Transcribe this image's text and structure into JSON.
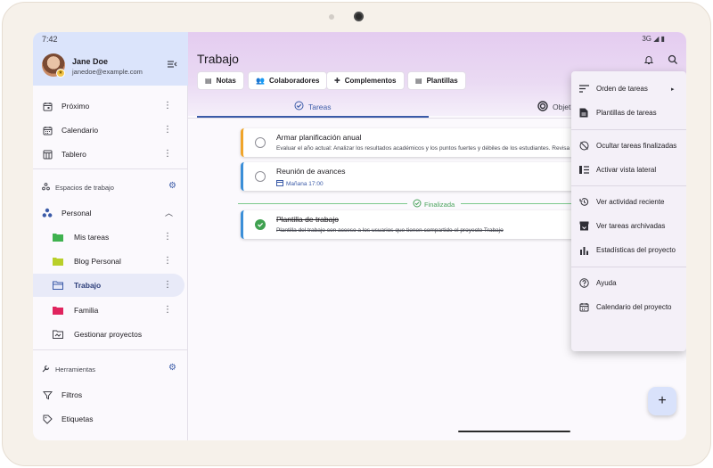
{
  "status": {
    "time": "7:42",
    "network": "3G"
  },
  "user": {
    "name": "Jane Doe",
    "email": "janedoe@example.com"
  },
  "sidebar": {
    "items": [
      {
        "label": "Próximo"
      },
      {
        "label": "Calendario"
      },
      {
        "label": "Tablero"
      }
    ],
    "workspaces_title": "Espacios de trabajo",
    "workspace": {
      "label": "Personal"
    },
    "projects": [
      {
        "label": "Mis tareas",
        "color": "#3fb24f"
      },
      {
        "label": "Blog Personal",
        "color": "#b9cf2a"
      },
      {
        "label": "Trabajo",
        "color": "#3b5ba8"
      },
      {
        "label": "Familia",
        "color": "#e0245e"
      }
    ],
    "manage_label": "Gestionar proyectos",
    "tools_title": "Herramientas",
    "tools": [
      {
        "label": "Filtros"
      },
      {
        "label": "Etiquetas"
      }
    ]
  },
  "main": {
    "title": "Trabajo",
    "chips": [
      {
        "label": "Notas",
        "icon": "note-icon"
      },
      {
        "label": "Colaboradores",
        "icon": "people-icon"
      },
      {
        "label": "Complementos",
        "icon": "puzzle-icon"
      },
      {
        "label": "Plantillas",
        "icon": "template-icon"
      }
    ],
    "tabs": [
      {
        "label": "Tareas",
        "icon": "check-circle-icon"
      },
      {
        "label": "Objeti",
        "icon": "target-icon"
      }
    ],
    "tasks": [
      {
        "title": "Armar planificación anual",
        "description": "Evaluar el año actual: Analizar los resultados académicos y los puntos fuertes y débiles de los estudiantes. Revisa",
        "accent": "#f0a52a"
      },
      {
        "title": "Reunión de avances",
        "due": "Mañana 17:00",
        "accent": "#3b8fd8"
      }
    ],
    "done_label": "Finalizada",
    "done_tasks": [
      {
        "title": "Plantilla de trabajo",
        "description": "Plantilla del trabajo con acceso a los usuarios que tienen compartido el proyecto Trabajo",
        "accent": "#3b8fd8"
      }
    ],
    "fab_label": "+"
  },
  "menu": {
    "items": [
      {
        "label": "Orden de tareas",
        "icon": "sort-icon",
        "submenu": "▸"
      },
      {
        "label": "Plantillas de tareas",
        "icon": "template-icon"
      },
      {
        "label": "Ocultar tareas finalizadas",
        "icon": "hide-done-icon"
      },
      {
        "label": "Activar vista lateral",
        "icon": "side-view-icon"
      },
      {
        "label": "Ver actividad reciente",
        "icon": "history-icon"
      },
      {
        "label": "Ver tareas archivadas",
        "icon": "archive-icon"
      },
      {
        "label": "Estadísticas del proyecto",
        "icon": "stats-icon"
      },
      {
        "label": "Ayuda",
        "icon": "help-icon"
      },
      {
        "label": "Calendario del proyecto",
        "icon": "calendar-icon"
      }
    ]
  }
}
